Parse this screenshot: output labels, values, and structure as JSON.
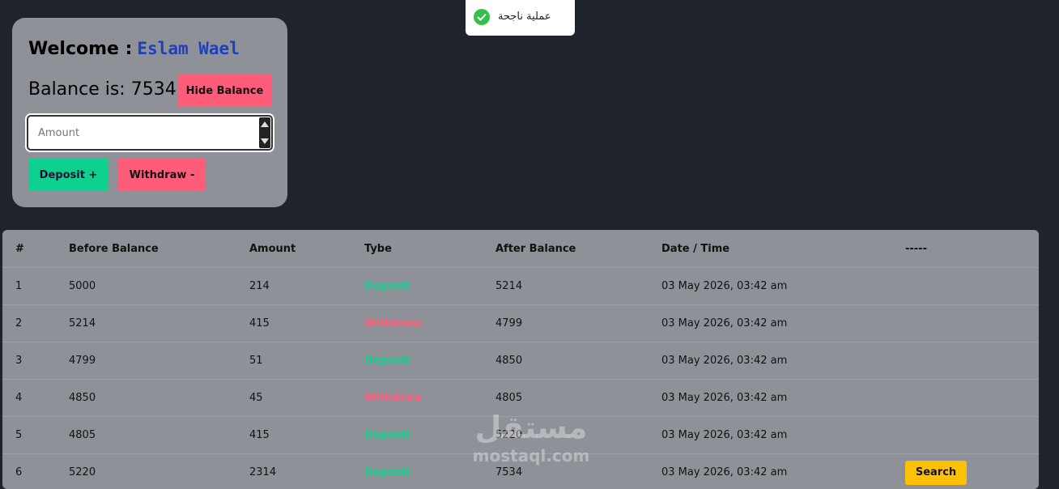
{
  "toast": {
    "message": "عملية ناجحة"
  },
  "account": {
    "welcome_label": "Welcome :",
    "user_name": "Eslam Wael",
    "balance_text": "Balance is: 7534",
    "hide_balance_label": "Hide Balance",
    "amount_placeholder": "Amount",
    "deposit_label": "Deposit +",
    "withdraw_label": "Withdraw -"
  },
  "table": {
    "headers": [
      "#",
      "Before Balance",
      "Amount",
      "Tybe",
      "After Balance",
      "Date / Time",
      "-----"
    ],
    "rows": [
      {
        "n": "1",
        "before": "5000",
        "amount": "214",
        "type": "Deposit",
        "after": "5214",
        "date": "03 May 2026, 03:42 am"
      },
      {
        "n": "2",
        "before": "5214",
        "amount": "415",
        "type": "Withdraw",
        "after": "4799",
        "date": "03 May 2026, 03:42 am"
      },
      {
        "n": "3",
        "before": "4799",
        "amount": "51",
        "type": "Deposit",
        "after": "4850",
        "date": "03 May 2026, 03:42 am"
      },
      {
        "n": "4",
        "before": "4850",
        "amount": "45",
        "type": "Withdraw",
        "after": "4805",
        "date": "03 May 2026, 03:42 am"
      },
      {
        "n": "5",
        "before": "4805",
        "amount": "415",
        "type": "Deposit",
        "after": "5220",
        "date": "03 May 2026, 03:42 am"
      },
      {
        "n": "6",
        "before": "5220",
        "amount": "2314",
        "type": "Deposit",
        "after": "7534",
        "date": "03 May 2026, 03:42 am",
        "action": "Search"
      }
    ]
  },
  "watermark": {
    "arabic": "مستقل",
    "latin": "mostaql.com"
  },
  "colors": {
    "deposit": "#0ed190",
    "withdraw": "#ff5c7a",
    "accent_name": "#1f3fbf",
    "search": "#ffc107"
  }
}
